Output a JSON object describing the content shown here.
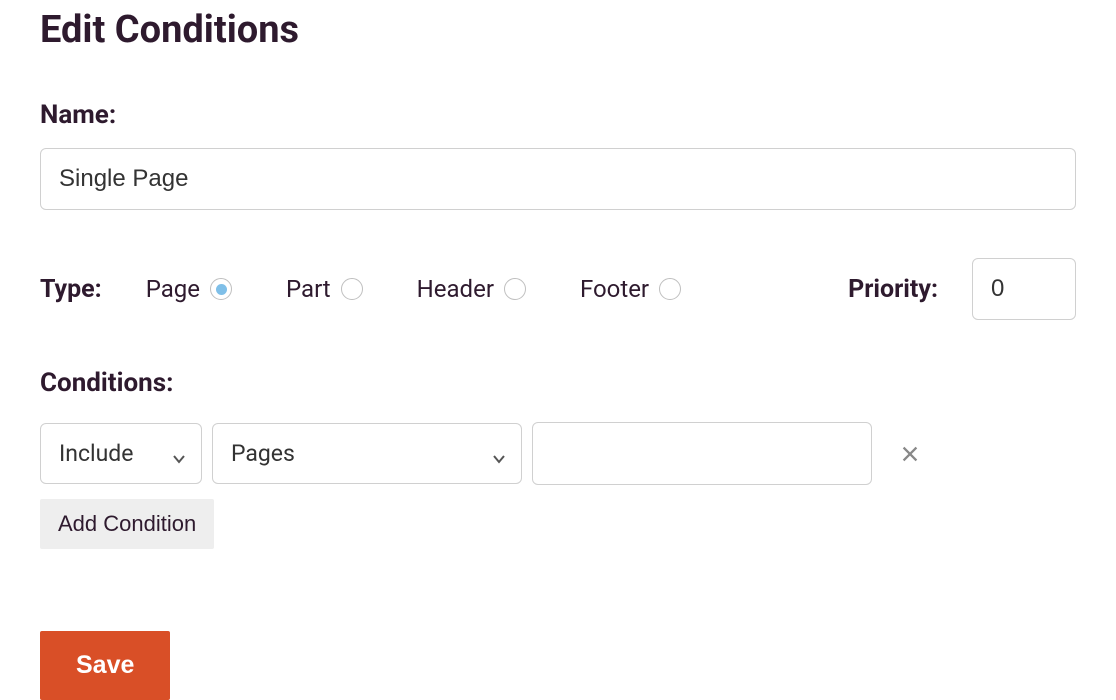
{
  "title": "Edit Conditions",
  "name": {
    "label": "Name:",
    "value": "Single Page"
  },
  "type": {
    "label": "Type:",
    "options": [
      {
        "label": "Page",
        "selected": true
      },
      {
        "label": "Part",
        "selected": false
      },
      {
        "label": "Header",
        "selected": false
      },
      {
        "label": "Footer",
        "selected": false
      }
    ]
  },
  "priority": {
    "label": "Priority:",
    "value": "0"
  },
  "conditions": {
    "label": "Conditions:",
    "rows": [
      {
        "inclusion": "Include",
        "scope": "Pages",
        "value": ""
      }
    ],
    "add_label": "Add Condition"
  },
  "save_label": "Save"
}
